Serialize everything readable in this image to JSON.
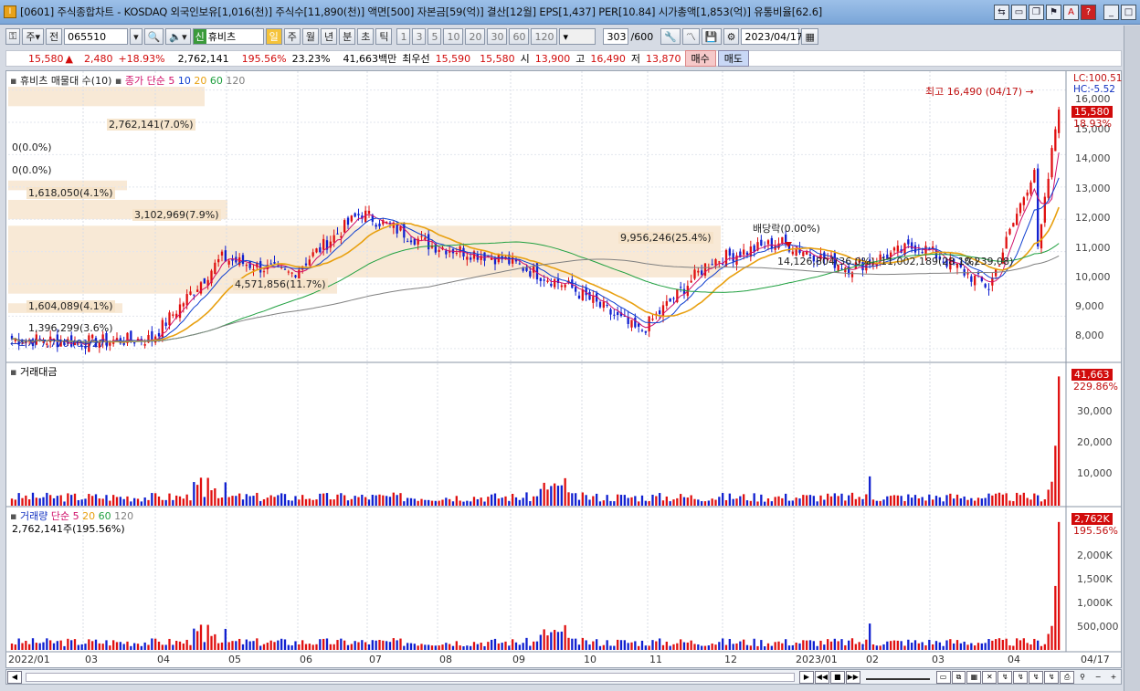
{
  "window": {
    "title": "[0601] 주식종합차트 - KOSDAQ 외국인보유[1,016(천)] 주식수[11,890(천)] 액면[500] 자본금[59(억)] 결산[12월] EPS[1,437] PER[10.84] 시가총액[1,853(억)] 유통비율[62.6]",
    "app_icon": "I"
  },
  "toolbar": {
    "market_type": "주",
    "view_mode": "전",
    "stock_code": "065510",
    "stock_name": "휴비츠",
    "stock_tag": "신",
    "periods": [
      "일",
      "주",
      "월",
      "년",
      "분",
      "초",
      "틱"
    ],
    "active_period": "일",
    "intervals": [
      "1",
      "3",
      "5",
      "10",
      "20",
      "30",
      "60",
      "120"
    ],
    "count_value": "303",
    "count_total": "/600",
    "date": "2023/04/17"
  },
  "quote": {
    "price": "15,580",
    "arrow": "▲",
    "change": "2,480",
    "change_pct": "+18.93%",
    "volume": "2,762,141",
    "volume_ratio": "195.56%",
    "turnover": "23.23%",
    "amount": "41,663백만",
    "best_label": "최우선",
    "best_ask": "15,590",
    "best_bid": "15,580",
    "open_label": "시",
    "open": "13,900",
    "high_label": "고",
    "high": "16,490",
    "low_label": "저",
    "low": "13,870",
    "buy_label": "매수",
    "sell_label": "매도"
  },
  "price_panel": {
    "legend_title": "휴비츠 매물대 수(10)",
    "legend_ma_label": "종가 단순",
    "legend_ma": [
      "5",
      "10",
      "20",
      "60",
      "120"
    ],
    "lc": "LC:100.51",
    "hc": "HC:-5.52",
    "current_price": "15,580",
    "current_pct": "18.93%",
    "high_note": "최고 16,490 (04/17)",
    "low_note": "최저 7,770 (01/27)",
    "dividend_note": "배당락(0.00%)",
    "volume_profile": [
      "2,762,141(7.0%)",
      "0(0.0%)",
      "0(0.0%)",
      "1,618,050(4.1%)",
      "3,102,969(7.9%)",
      "9,956,246(25.4%)",
      "14,126,804(36.0%)",
      "11,002,189(28.1%)",
      "10,239,08)",
      "4,571,856(11.7%)",
      "1,604,089(4.1%)",
      "1,396,299(3.6%)"
    ],
    "y_ticks": [
      "16,000",
      "15,000",
      "14,000",
      "13,000",
      "12,000",
      "11,000",
      "10,000",
      "9,000",
      "8,000"
    ]
  },
  "amount_panel": {
    "legend": "거래대금",
    "current": "41,663",
    "current_pct": "229.86%",
    "y_ticks": [
      "30,000",
      "20,000",
      "10,000"
    ]
  },
  "volume_panel": {
    "legend_title": "거래량",
    "legend_ma_label": "단순",
    "legend_ma": [
      "5",
      "20",
      "60",
      "120"
    ],
    "sub_legend": "2,762,141주(195.56%)",
    "current": "2,762K",
    "current_pct": "195.56%",
    "y_ticks": [
      "2,000K",
      "1,500K",
      "1,000K",
      "500,000"
    ]
  },
  "x_axis": [
    "2022/01",
    "03",
    "04",
    "05",
    "06",
    "07",
    "08",
    "09",
    "10",
    "11",
    "12",
    "2023/01",
    "02",
    "03",
    "04"
  ],
  "x_axis_end": "04/17",
  "colors": {
    "up": "#e01010",
    "down": "#1020d0",
    "ma5": "#d0106a",
    "ma10": "#1040d0",
    "ma20": "#e8a010",
    "ma60": "#20a040",
    "ma120": "#808080"
  },
  "chart_data": {
    "type": "candlestick",
    "x_start": "2022/01",
    "x_end": "2023/04/17",
    "close_path_months": [
      "2022/01",
      "02",
      "03",
      "04",
      "05",
      "06",
      "07",
      "08",
      "09",
      "10",
      "11",
      "12",
      "2023/01",
      "02",
      "03",
      "04"
    ],
    "approx_close": [
      8300,
      8200,
      8300,
      10800,
      10300,
      12200,
      11200,
      10800,
      9900,
      8500,
      10700,
      11300,
      10500,
      11200,
      9900,
      15580
    ],
    "ylim": [
      7600,
      16300
    ]
  }
}
